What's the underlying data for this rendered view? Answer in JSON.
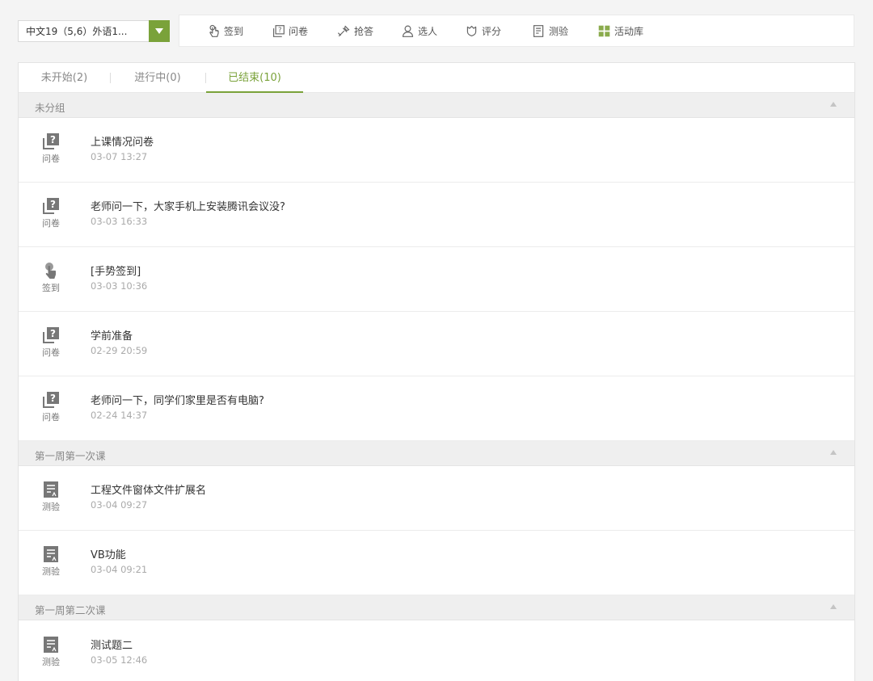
{
  "class_select": {
    "value": "中文19（5,6）外语1..."
  },
  "toolbar": [
    {
      "label": "签到",
      "icon": "hand-tap-icon"
    },
    {
      "label": "问卷",
      "icon": "questionnaire-icon"
    },
    {
      "label": "抢答",
      "icon": "quick-answer-icon"
    },
    {
      "label": "选人",
      "icon": "person-icon"
    },
    {
      "label": "评分",
      "icon": "rating-icon"
    },
    {
      "label": "测验",
      "icon": "quiz-icon"
    },
    {
      "label": "活动库",
      "icon": "grid-icon"
    }
  ],
  "tabs": [
    {
      "label": "未开始(2)"
    },
    {
      "label": "进行中(0)"
    },
    {
      "label": "已结束(10)"
    }
  ],
  "groups": [
    {
      "title": "未分组",
      "items": [
        {
          "type": "问卷",
          "icon": "questionnaire-icon",
          "title": "上课情况问卷",
          "time": "03-07 13:27"
        },
        {
          "type": "问卷",
          "icon": "questionnaire-icon",
          "title": "老师问一下，大家手机上安装腾讯会议没?",
          "time": "03-03 16:33"
        },
        {
          "type": "签到",
          "icon": "hand-tap-icon",
          "title": "[手势签到]",
          "time": "03-03 10:36"
        },
        {
          "type": "问卷",
          "icon": "questionnaire-icon",
          "title": "学前准备",
          "time": "02-29 20:59"
        },
        {
          "type": "问卷",
          "icon": "questionnaire-icon",
          "title": "老师问一下，同学们家里是否有电脑?",
          "time": "02-24 14:37"
        }
      ]
    },
    {
      "title": "第一周第一次课",
      "items": [
        {
          "type": "测验",
          "icon": "quiz-icon",
          "title": "工程文件窗体文件扩展名",
          "time": "03-04 09:27"
        },
        {
          "type": "测验",
          "icon": "quiz-icon",
          "title": "VB功能",
          "time": "03-04 09:21"
        }
      ]
    },
    {
      "title": "第一周第二次课",
      "items": [
        {
          "type": "测验",
          "icon": "quiz-icon",
          "title": "测试题二",
          "time": "03-05 12:46"
        }
      ]
    }
  ],
  "colors": {
    "accent": "#7aa23a",
    "icon_gray": "#777777"
  }
}
